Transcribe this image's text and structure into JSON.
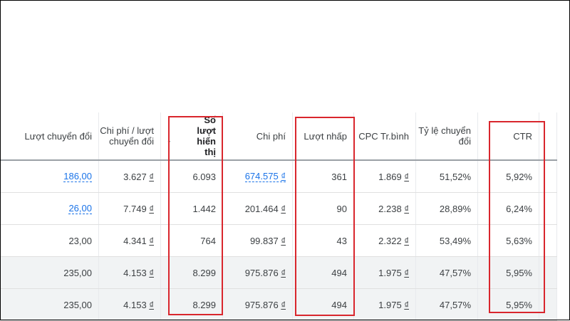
{
  "columns": [
    "Lượt chuyển đổi",
    "Chi phí / lượt chuyển đổi",
    "Số lượt hiển thị",
    "Chi phí",
    "Lượt nhấp",
    "CPC Tr.bình",
    "Tỷ lệ chuyển đổi",
    "CTR"
  ],
  "sort": {
    "column": "Số lượt hiển thị",
    "direction": "descending",
    "icon": "arrow-down-icon"
  },
  "currency_symbol": "₫",
  "rows": [
    {
      "conversions": "186,00",
      "cost_per_conv": "3.627",
      "impressions": "6.093",
      "cost": "674.575",
      "clicks": "361",
      "avg_cpc": "1.869",
      "conv_rate": "51,52%",
      "ctr": "5,92%"
    },
    {
      "conversions": "26,00",
      "cost_per_conv": "7.749",
      "impressions": "1.442",
      "cost": "201.464",
      "clicks": "90",
      "avg_cpc": "2.238",
      "conv_rate": "28,89%",
      "ctr": "6,24%"
    },
    {
      "conversions": "23,00",
      "cost_per_conv": "4.341",
      "impressions": "764",
      "cost": "99.837",
      "clicks": "43",
      "avg_cpc": "2.322",
      "conv_rate": "53,49%",
      "ctr": "5,63%"
    },
    {
      "conversions": "235,00",
      "cost_per_conv": "4.153",
      "impressions": "8.299",
      "cost": "975.876",
      "clicks": "494",
      "avg_cpc": "1.975",
      "conv_rate": "47,57%",
      "ctr": "5,95%"
    },
    {
      "conversions": "235,00",
      "cost_per_conv": "4.153",
      "impressions": "8.299",
      "cost": "975.876",
      "clicks": "494",
      "avg_cpc": "1.975",
      "conv_rate": "47,57%",
      "ctr": "5,95%"
    }
  ],
  "colors": {
    "link": "#1a73e8",
    "highlight_box": "#d9262d",
    "shaded_row": "#f1f3f4"
  }
}
